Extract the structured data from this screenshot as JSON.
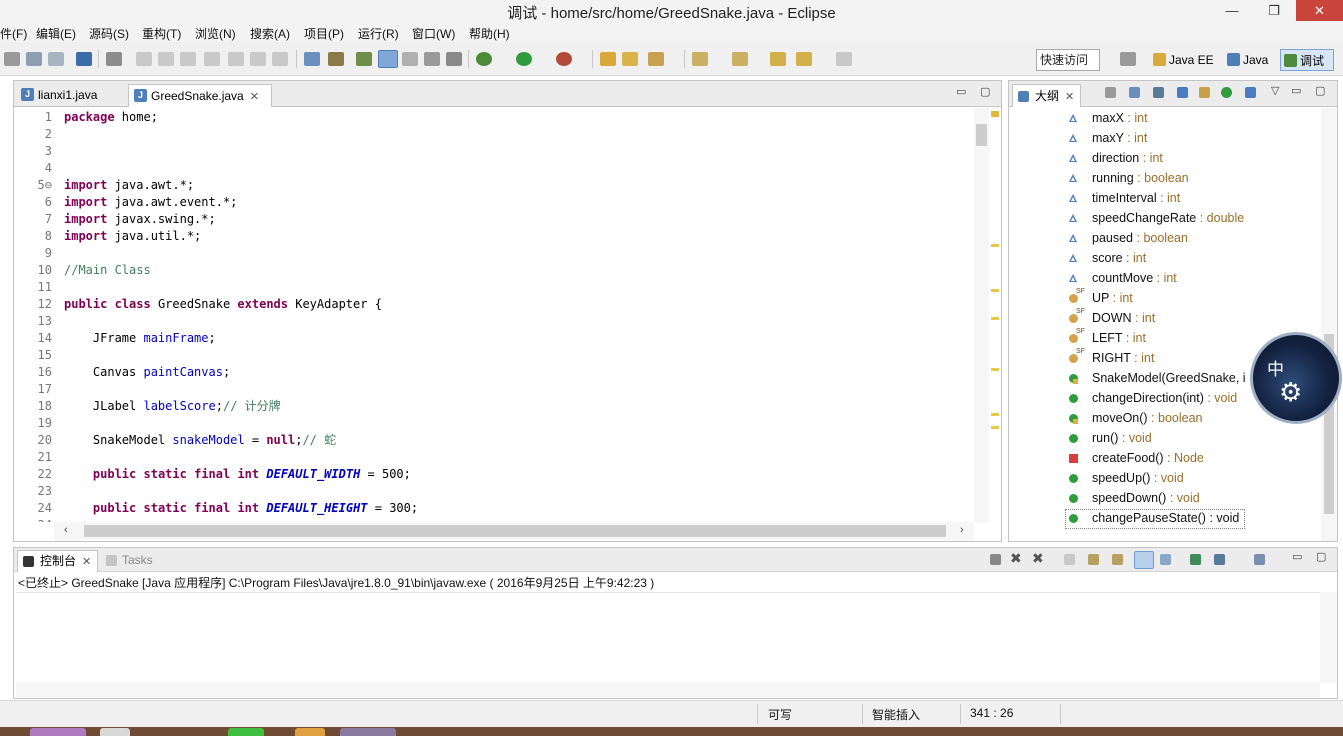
{
  "window": {
    "title": "调试  -  home/src/home/GreedSnake.java  -  Eclipse",
    "restore_glyph": "❐",
    "minimize_glyph": "—",
    "close_glyph": "✕"
  },
  "menu": [
    "件(F)",
    "编辑(E)",
    "源码(S)",
    "重构(T)",
    "浏览(N)",
    "搜索(A)",
    "项目(P)",
    "运行(R)",
    "窗口(W)",
    "帮助(H)"
  ],
  "toolbar": {
    "quick_access": "快速访问",
    "perspectives": [
      "Java EE",
      "Java",
      "调试"
    ]
  },
  "editor": {
    "tabs": [
      {
        "label": "lianxi1.java"
      },
      {
        "label": "GreedSnake.java"
      }
    ],
    "lines": [
      {
        "n": "1",
        "html": "<span class='kw'>package</span> home;"
      },
      {
        "n": "2",
        "html": ""
      },
      {
        "n": "3",
        "html": ""
      },
      {
        "n": "4",
        "html": ""
      },
      {
        "n": "5⊖",
        "html": "<span class='kw'>import</span> java.awt.*;"
      },
      {
        "n": "6",
        "html": "<span class='kw'>import</span> java.awt.event.*;"
      },
      {
        "n": "7",
        "html": "<span class='kw'>import</span> javax.swing.*;"
      },
      {
        "n": "8",
        "html": "<span class='kw'>import</span> java.util.*;"
      },
      {
        "n": "9",
        "html": ""
      },
      {
        "n": "10",
        "html": "<span class='cm'>//Main Class</span>"
      },
      {
        "n": "11",
        "html": ""
      },
      {
        "n": "12",
        "html": "<span class='kw'>public</span> <span class='kw'>class</span> GreedSnake <span class='kw'>extends</span> KeyAdapter {"
      },
      {
        "n": "13",
        "html": ""
      },
      {
        "n": "14",
        "html": "    JFrame <span class='fld'>mainFrame</span>;"
      },
      {
        "n": "15",
        "html": ""
      },
      {
        "n": "16",
        "html": "    Canvas <span class='fld'>paintCanvas</span>;"
      },
      {
        "n": "17",
        "html": ""
      },
      {
        "n": "18",
        "html": "    JLabel <span class='fld'>labelScore</span>;<span class='cm'>// 计分牌</span>"
      },
      {
        "n": "19",
        "html": ""
      },
      {
        "n": "20",
        "html": "    SnakeModel <span class='fld'>snakeModel</span> = <span class='kw'>null</span>;<span class='cm'>// 蛇</span>"
      },
      {
        "n": "21",
        "html": ""
      },
      {
        "n": "22",
        "html": "    <span class='kw'>public</span> <span class='kw'>static</span> <span class='kw'>final</span> <span class='kw'>int</span> <span class='cst'>DEFAULT_WIDTH</span> = 500;"
      },
      {
        "n": "23",
        "html": ""
      },
      {
        "n": "24",
        "html": "    <span class='kw'>public</span> <span class='kw'>static</span> <span class='kw'>final</span> <span class='kw'>int</span> <span class='cst'>DEFAULT_HEIGHT</span> = 300;"
      },
      {
        "n": "24",
        "html": ""
      }
    ]
  },
  "outline": {
    "tab_label": "大纲",
    "items": [
      {
        "name": "maxX",
        "sep": " : ",
        "type": "int",
        "icon": "tri"
      },
      {
        "name": "maxY",
        "sep": " : ",
        "type": "int",
        "icon": "tri"
      },
      {
        "name": "direction",
        "sep": " : ",
        "type": "int",
        "icon": "tri"
      },
      {
        "name": "running",
        "sep": " : ",
        "type": "boolean",
        "icon": "tri"
      },
      {
        "name": "timeInterval",
        "sep": " : ",
        "type": "int",
        "icon": "tri"
      },
      {
        "name": "speedChangeRate",
        "sep": " : ",
        "type": "double",
        "icon": "tri"
      },
      {
        "name": "paused",
        "sep": " : ",
        "type": "boolean",
        "icon": "tri"
      },
      {
        "name": "score",
        "sep": " : ",
        "type": "int",
        "icon": "tri"
      },
      {
        "name": "countMove",
        "sep": " : ",
        "type": "int",
        "icon": "tri"
      },
      {
        "name": "UP",
        "sep": " : ",
        "type": "int",
        "icon": "sf"
      },
      {
        "name": "DOWN",
        "sep": " : ",
        "type": "int",
        "icon": "sf"
      },
      {
        "name": "LEFT",
        "sep": " : ",
        "type": "int",
        "icon": "sf"
      },
      {
        "name": "RIGHT",
        "sep": " : ",
        "type": "int",
        "icon": "sf"
      },
      {
        "name": "SnakeModel(GreedSnake, i",
        "sep": "",
        "type": "",
        "icon": "dotx"
      },
      {
        "name": "changeDirection(int)",
        "sep": " : ",
        "type": "void",
        "icon": "dot"
      },
      {
        "name": "moveOn()",
        "sep": " : ",
        "type": "boolean",
        "icon": "dotx"
      },
      {
        "name": "run()",
        "sep": " : ",
        "type": "void",
        "icon": "dot"
      },
      {
        "name": "createFood()",
        "sep": " : ",
        "type": "Node",
        "icon": "sq"
      },
      {
        "name": "speedUp()",
        "sep": " : ",
        "type": "void",
        "icon": "dot"
      },
      {
        "name": "speedDown()",
        "sep": " : ",
        "type": "void",
        "icon": "dot"
      },
      {
        "name": "changePauseState()",
        "sep": " : ",
        "type": "void",
        "icon": "dot"
      }
    ]
  },
  "ime": {
    "label": "中",
    "gear": "⚙"
  },
  "console": {
    "tabs": [
      "控制台",
      "Tasks"
    ],
    "status_line": "<已终止> GreedSnake [Java 应用程序] C:\\Program Files\\Java\\jre1.8.0_91\\bin\\javaw.exe ( 2016年9月25日 上午9:42:23 )"
  },
  "statusbar": {
    "writable": "可写",
    "insert_mode": "智能插入",
    "position": "341 : 26"
  },
  "colors": {
    "keyword": "#7f0055",
    "comment": "#3f7f5f",
    "field": "#0000c0",
    "type_suffix": "#9a6f2a",
    "close_button": "#c9443b"
  }
}
